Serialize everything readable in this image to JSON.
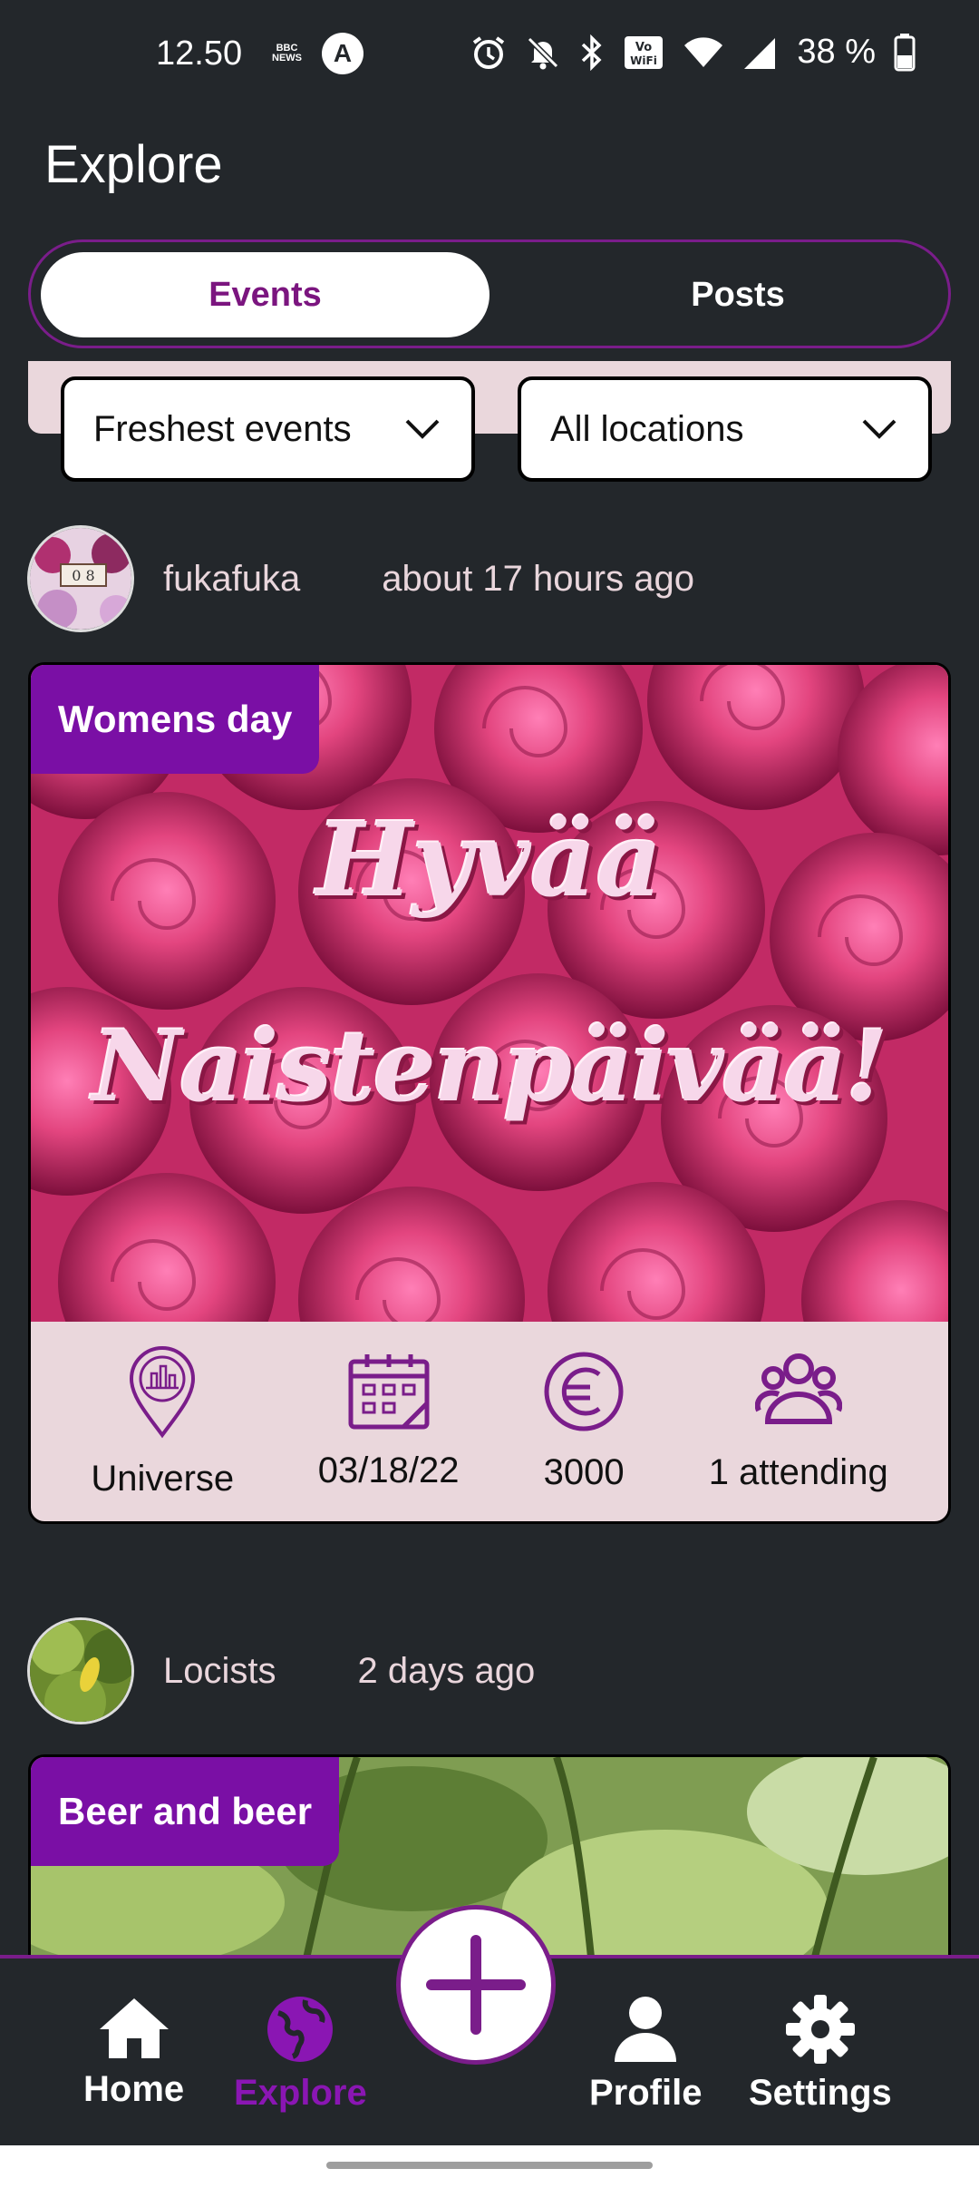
{
  "status_bar": {
    "time": "12.50",
    "bbc_line1": "BBC",
    "bbc_line2": "NEWS",
    "a_glyph": "A",
    "battery": "38 %"
  },
  "header": {
    "title": "Explore"
  },
  "tabs": [
    {
      "label": "Events",
      "active": true
    },
    {
      "label": "Posts",
      "active": false
    }
  ],
  "filters": {
    "sort": "Freshest events",
    "location": "All locations"
  },
  "posts": [
    {
      "author": "fukafuka",
      "time_ago": "about 17 hours ago",
      "tag": "Womens day",
      "image_text_line1": "Hyvää",
      "image_text_line2": "Naistenpäivää!",
      "location": "Universe",
      "date": "03/18/22",
      "price": "3000",
      "attending": "1 attending"
    },
    {
      "author": "Locists",
      "time_ago": "2 days ago",
      "tag": "Beer and beer"
    }
  ],
  "nav": {
    "items": [
      {
        "label": "Home",
        "icon": "home-icon",
        "active": false
      },
      {
        "label": "Explore",
        "icon": "globe-icon",
        "active": true
      },
      {
        "label": "Profile",
        "icon": "person-icon",
        "active": false
      },
      {
        "label": "Settings",
        "icon": "gear-icon",
        "active": false
      }
    ],
    "fab_icon": "plus-icon"
  },
  "colors": {
    "background": "#23272b",
    "accent": "#7a1d8a",
    "tag": "#7a0fa5",
    "card": "#ead7dc"
  }
}
